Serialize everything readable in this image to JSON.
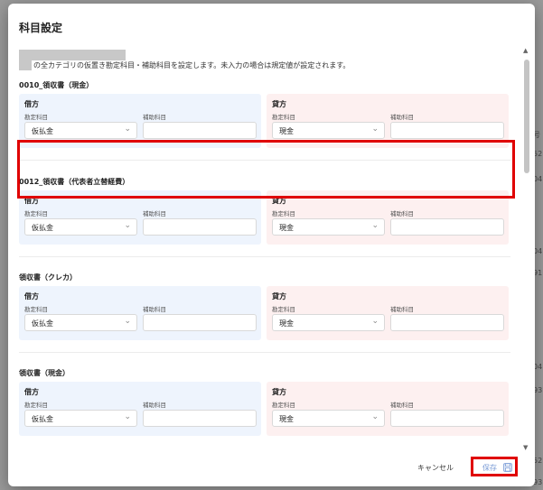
{
  "modal": {
    "title": "科目設定",
    "description": "の全カテゴリの仮置き勘定科目・補助科目を設定します。未入力の場合は規定値が設定されます。"
  },
  "labels": {
    "debit": "借方",
    "credit": "貸方",
    "account": "勘定科目",
    "sub_account": "補助科目"
  },
  "sections": [
    {
      "title": "0010_領収書（現金）",
      "debit_account": "仮払金",
      "credit_account": "現金"
    },
    {
      "title": "0012_領収書（代表者立替経費）",
      "debit_account": "仮払金",
      "credit_account": "現金"
    },
    {
      "title": "領収書（クレカ）",
      "debit_account": "仮払金",
      "credit_account": "現金"
    },
    {
      "title": "領収書（現金）",
      "debit_account": "仮払金",
      "credit_account": "現金"
    }
  ],
  "footer": {
    "cancel_label": "キャンセル",
    "save_label": "保存"
  },
  "background": {
    "snippets": [
      "号",
      "52",
      "04",
      "04",
      "91",
      "04",
      "93",
      "52",
      "93"
    ]
  },
  "colors": {
    "highlight": "#e00000",
    "debit_bg": "#eef4fd",
    "credit_bg": "#fdf0f0",
    "save_text": "#7a9bd6"
  }
}
